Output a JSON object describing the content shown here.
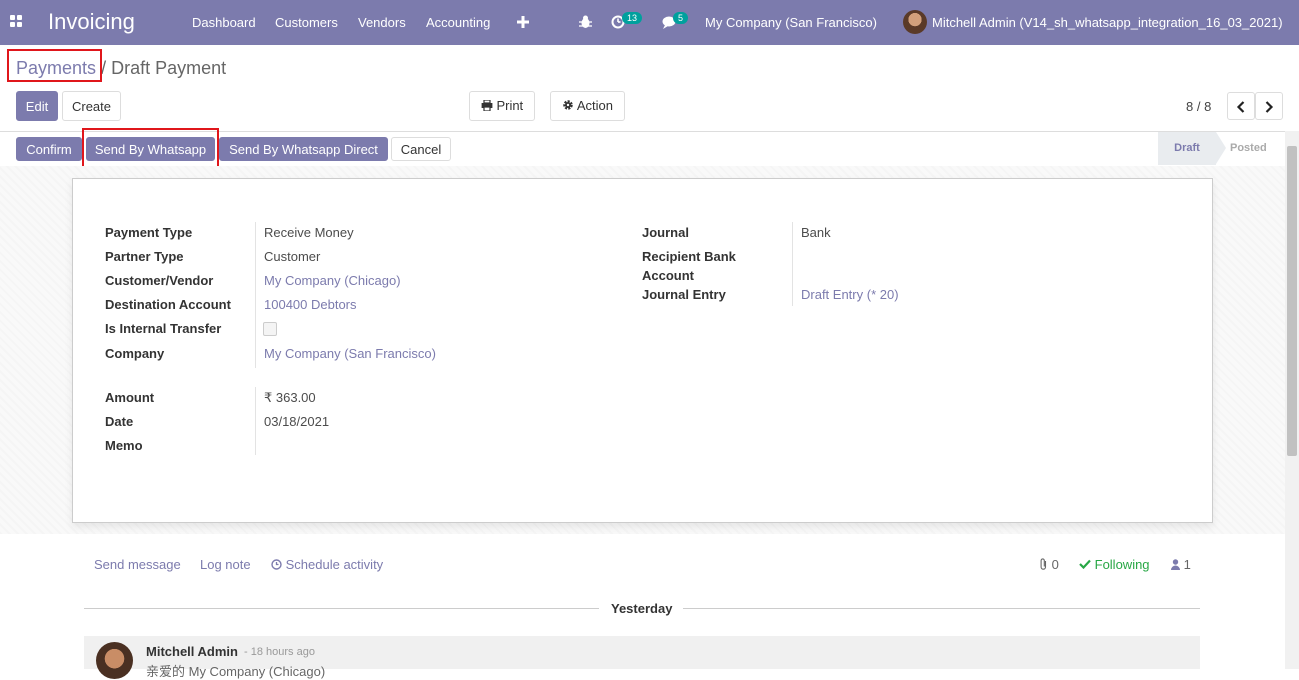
{
  "navbar": {
    "app_name": "Invoicing",
    "menu": [
      "Dashboard",
      "Customers",
      "Vendors",
      "Accounting"
    ],
    "plus_icon": "plus-icon",
    "bug_icon": "bug-icon",
    "activity_count": "13",
    "message_count": "5",
    "company": "My Company (San Francisco)",
    "user": "Mitchell Admin (V14_sh_whatsapp_integration_16_03_2021)"
  },
  "breadcrumb": {
    "parent": "Payments",
    "separator": "/",
    "current": "Draft Payment"
  },
  "control": {
    "edit": "Edit",
    "create": "Create",
    "print": "Print",
    "action": "Action",
    "pager": "8 / 8"
  },
  "statusbar": {
    "buttons": [
      "Confirm",
      "Send By Whatsapp",
      "Send By Whatsapp Direct",
      "Cancel"
    ],
    "stages": [
      "Draft",
      "Posted"
    ],
    "active_stage": "Draft"
  },
  "form": {
    "left": [
      {
        "label": "Payment Type",
        "value": "Receive Money"
      },
      {
        "label": "Partner Type",
        "value": "Customer"
      },
      {
        "label": "Customer/Vendor",
        "value": "My Company (Chicago)"
      },
      {
        "label": "Destination Account",
        "value": "100400 Debtors"
      },
      {
        "label": "Is Internal Transfer",
        "value": ""
      },
      {
        "label": "Company",
        "value": "My Company (San Francisco)"
      }
    ],
    "amounts": [
      {
        "label": "Amount",
        "value": "₹ 363.00"
      },
      {
        "label": "Date",
        "value": "03/18/2021"
      },
      {
        "label": "Memo",
        "value": ""
      }
    ],
    "right": [
      {
        "label": "Journal",
        "value": "Bank"
      },
      {
        "label": "Recipient Bank",
        "label2": "Account",
        "value": ""
      },
      {
        "label": "Journal Entry",
        "value": "Draft Entry (* 20)"
      }
    ]
  },
  "chatter": {
    "send_message": "Send message",
    "log_note": "Log note",
    "schedule_activity": "Schedule activity",
    "attachments": "0",
    "following": "Following",
    "followers": "1",
    "day": "Yesterday",
    "message": {
      "author": "Mitchell Admin",
      "time": "- 18 hours ago",
      "body": "亲爱的 My Company (Chicago)"
    }
  },
  "colors": {
    "primary": "#7c7bad",
    "highlight": "#e0161b",
    "following": "#28a745"
  }
}
